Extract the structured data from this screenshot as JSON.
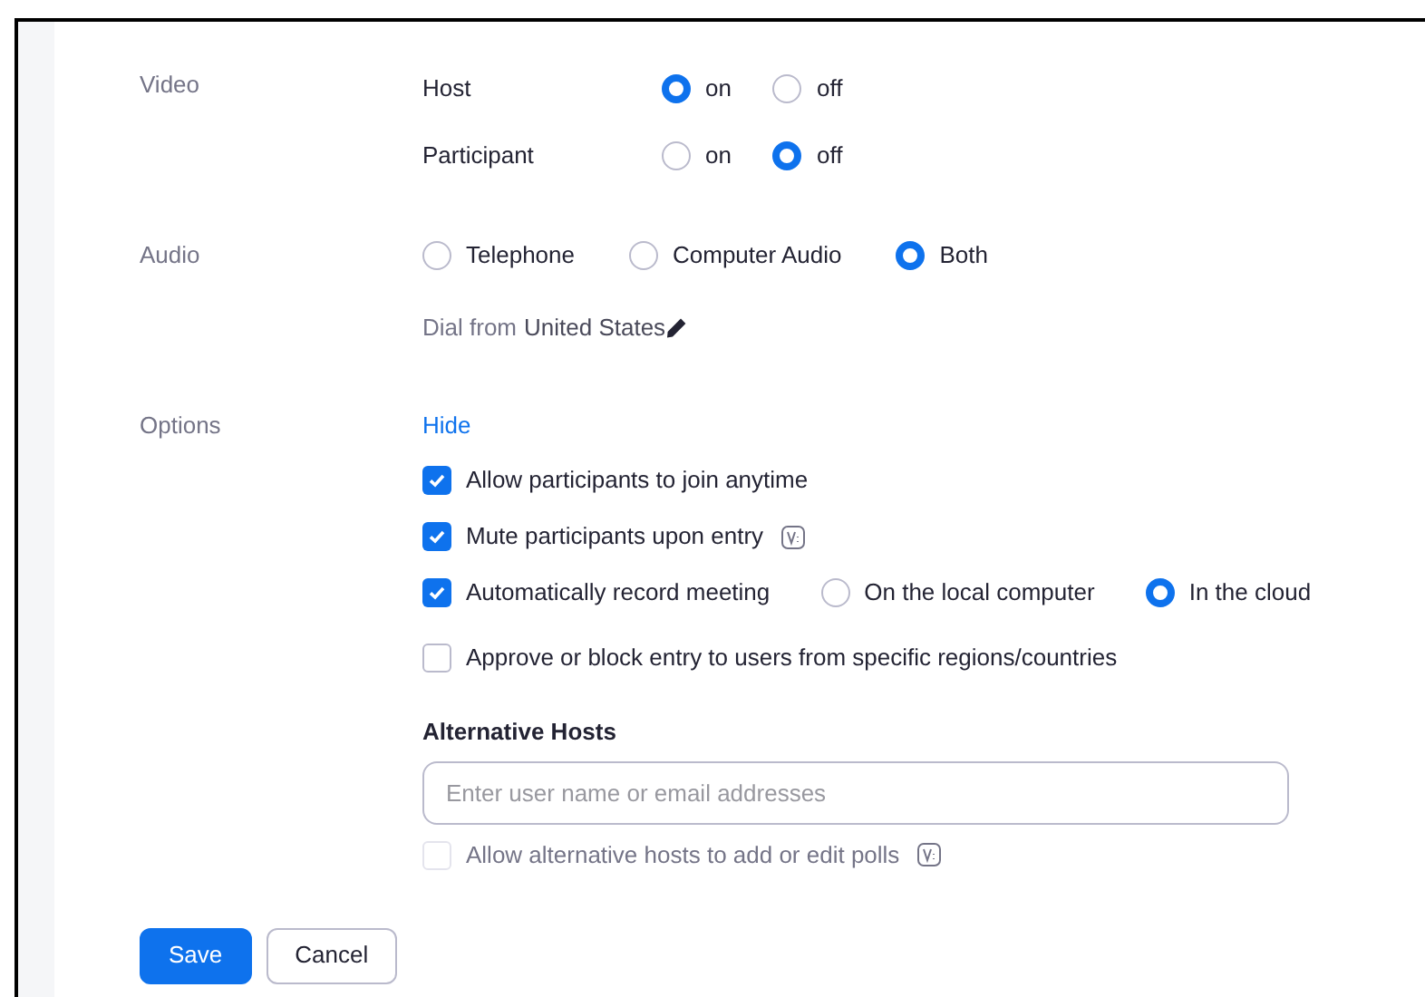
{
  "video": {
    "label": "Video",
    "rows": [
      {
        "label": "Host",
        "options": [
          {
            "label": "on",
            "selected": true
          },
          {
            "label": "off",
            "selected": false
          }
        ]
      },
      {
        "label": "Participant",
        "options": [
          {
            "label": "on",
            "selected": false
          },
          {
            "label": "off",
            "selected": true
          }
        ]
      }
    ]
  },
  "audio": {
    "label": "Audio",
    "options": [
      {
        "label": "Telephone",
        "selected": false
      },
      {
        "label": "Computer Audio",
        "selected": false
      },
      {
        "label": "Both",
        "selected": true
      }
    ],
    "dial_prefix": "Dial from",
    "dial_country": "United States"
  },
  "options": {
    "label": "Options",
    "toggle": "Hide",
    "items": [
      {
        "label": "Allow participants to join anytime",
        "checked": true
      },
      {
        "label": "Mute participants upon entry",
        "checked": true,
        "badge": true
      },
      {
        "label": "Automatically record meeting",
        "checked": true,
        "choices": [
          {
            "label": "On the local computer",
            "selected": false
          },
          {
            "label": "In the cloud",
            "selected": true
          }
        ]
      },
      {
        "label": "Approve or block entry to users from specific regions/countries",
        "checked": false
      }
    ],
    "alternative_hosts": {
      "heading": "Alternative Hosts",
      "placeholder": "Enter user name or email addresses",
      "poll": {
        "label": "Allow alternative hosts to add or edit polls",
        "checked": false,
        "disabled": true,
        "badge": true
      }
    }
  },
  "buttons": [
    {
      "label": "Save",
      "kind": "primary"
    },
    {
      "label": "Cancel",
      "kind": "secondary"
    }
  ]
}
